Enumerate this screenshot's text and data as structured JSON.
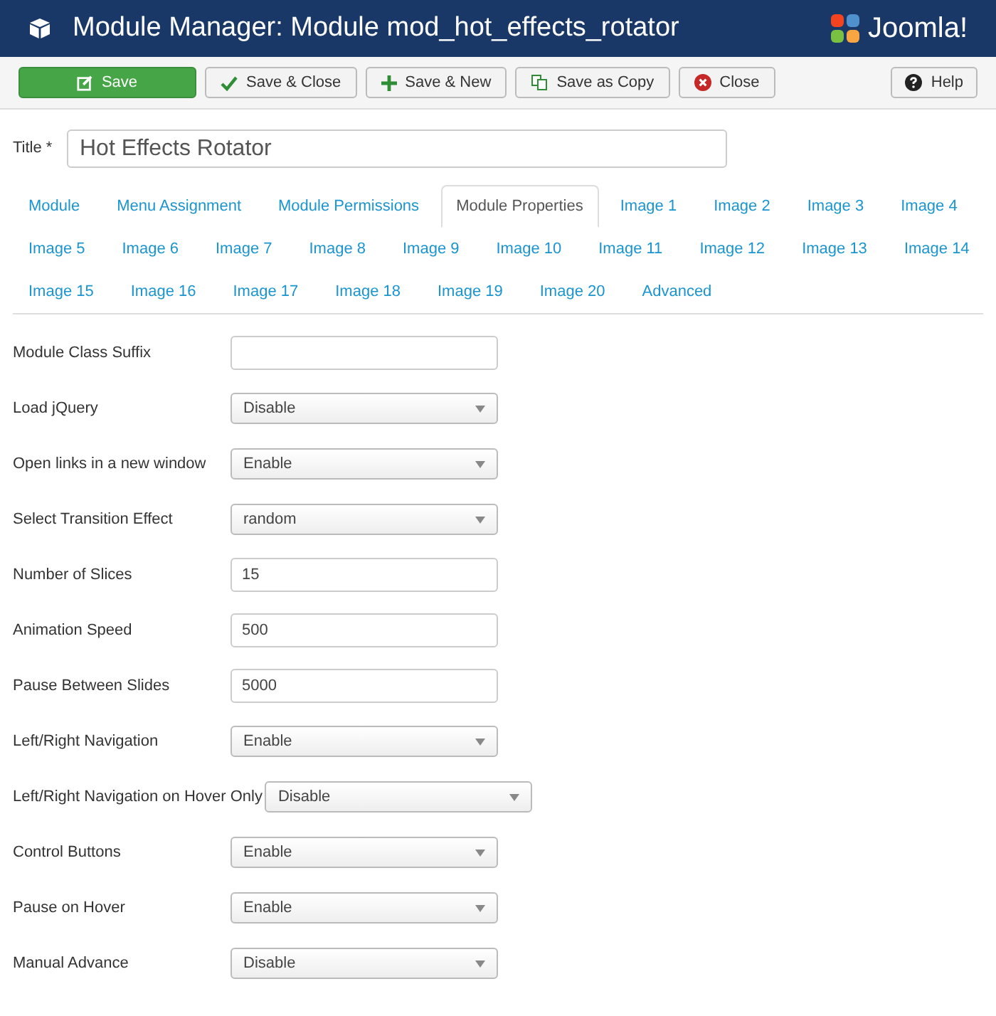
{
  "header": {
    "title": "Module Manager: Module mod_hot_effects_rotator",
    "logo_text": "Joomla!"
  },
  "toolbar": [
    {
      "kind": "save",
      "label": "Save"
    },
    {
      "kind": "check",
      "label": "Save & Close"
    },
    {
      "kind": "plus",
      "label": "Save & New"
    },
    {
      "kind": "copy",
      "label": "Save as Copy"
    },
    {
      "kind": "close",
      "label": "Close"
    }
  ],
  "help": {
    "label": "Help"
  },
  "title_field": {
    "label": "Title *",
    "value": "Hot Effects Rotator"
  },
  "tab_rows": [
    [
      {
        "label": "Module",
        "selected": false
      },
      {
        "label": "Menu Assignment",
        "selected": false
      },
      {
        "label": "Module Permissions",
        "selected": false
      },
      {
        "label": "Module Properties",
        "selected": true
      },
      {
        "label": "Image 1",
        "selected": false
      },
      {
        "label": "Image 2",
        "selected": false
      },
      {
        "label": "Image 3",
        "selected": false
      },
      {
        "label": "Image 4",
        "selected": false
      }
    ],
    [
      {
        "label": "Image 5",
        "selected": false
      },
      {
        "label": "Image 6",
        "selected": false
      },
      {
        "label": "Image 7",
        "selected": false
      },
      {
        "label": "Image 8",
        "selected": false
      },
      {
        "label": "Image 9",
        "selected": false
      },
      {
        "label": "Image 10",
        "selected": false
      },
      {
        "label": "Image 11",
        "selected": false
      },
      {
        "label": "Image 12",
        "selected": false
      },
      {
        "label": "Image 13",
        "selected": false
      },
      {
        "label": "Image 14",
        "selected": false
      }
    ],
    [
      {
        "label": "Image 15",
        "selected": false
      },
      {
        "label": "Image 16",
        "selected": false
      },
      {
        "label": "Image 17",
        "selected": false
      },
      {
        "label": "Image 18",
        "selected": false
      },
      {
        "label": "Image 19",
        "selected": false
      },
      {
        "label": "Image 20",
        "selected": false
      },
      {
        "label": "Advanced",
        "selected": false
      }
    ]
  ],
  "fields": [
    {
      "label": "Module Class Suffix",
      "kind": "text"
    },
    {
      "label": "Load jQuery",
      "kind": "select",
      "value": "Disable"
    },
    {
      "label": "Open links in a new window",
      "kind": "select",
      "value": "Enable"
    },
    {
      "label": "Select Transition Effect",
      "kind": "select",
      "value": "random"
    },
    {
      "label": "Number of Slices",
      "kind": "text",
      "value": "15"
    },
    {
      "label": "Animation Speed",
      "kind": "text",
      "value": "500"
    },
    {
      "label": "Pause Between Slides",
      "kind": "text",
      "value": "5000"
    },
    {
      "label": "Left/Right Navigation",
      "kind": "select",
      "value": "Enable"
    },
    {
      "label": "Left/Right Navigation on Hover Only",
      "kind": "select",
      "value": "Disable"
    },
    {
      "label": "Control Buttons",
      "kind": "select",
      "value": "Enable"
    },
    {
      "label": "Pause on Hover",
      "kind": "select",
      "value": "Enable"
    },
    {
      "label": "Manual Advance",
      "kind": "select",
      "value": "Disable"
    }
  ]
}
